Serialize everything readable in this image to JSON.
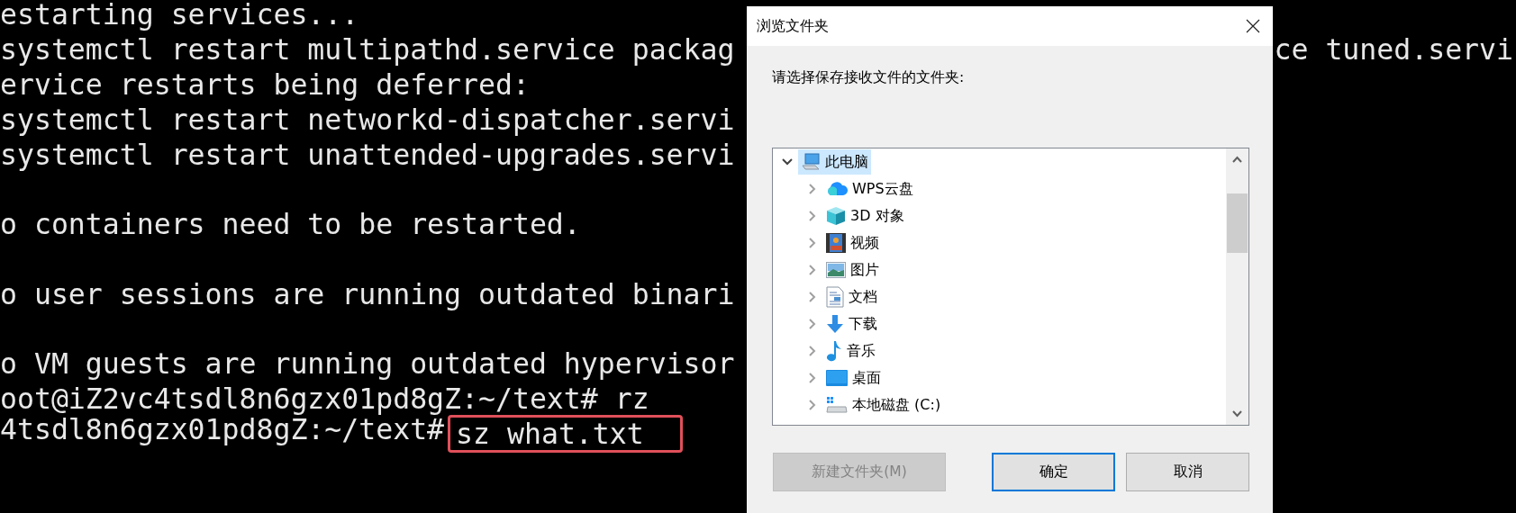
{
  "terminal": {
    "lines": [
      {
        "kind": "text",
        "text": "estarting services..."
      },
      {
        "kind": "text",
        "text": "systemctl restart multipathd.service packag",
        "right_text": "ce tuned.servi"
      },
      {
        "kind": "text",
        "text": "ervice restarts being deferred:"
      },
      {
        "kind": "text",
        "text": "systemctl restart networkd-dispatcher.servi"
      },
      {
        "kind": "text",
        "text": "systemctl restart unattended-upgrades.servi"
      },
      {
        "kind": "blank"
      },
      {
        "kind": "text",
        "text": "o containers need to be restarted."
      },
      {
        "kind": "blank"
      },
      {
        "kind": "text",
        "text": "o user sessions are running outdated binari"
      },
      {
        "kind": "blank"
      },
      {
        "kind": "text",
        "text": "o VM guests are running outdated hypervisor"
      },
      {
        "kind": "text",
        "text": "oot@iZ2vc4tsdl8n6gzx01pd8gZ:~/text# rz"
      },
      {
        "kind": "text",
        "text": "4tsdl8n6gzx01pd8gZ:~/text#",
        "command": "sz what.txt",
        "highlighted": true
      }
    ]
  },
  "dialog": {
    "title": "浏览文件夹",
    "prompt": "请选择保存接收文件的文件夹:",
    "tree": {
      "items": [
        {
          "label": "此电脑",
          "kind": "computer",
          "expanded": true,
          "selected": true,
          "children": [
            {
              "label": "WPS云盘",
              "kind": "cloud",
              "expanded": false,
              "selected": false
            },
            {
              "label": "3D 对象",
              "kind": "cube",
              "expanded": false,
              "selected": false
            },
            {
              "label": "视频",
              "kind": "video",
              "expanded": false,
              "selected": false
            },
            {
              "label": "图片",
              "kind": "pictures",
              "expanded": false,
              "selected": false
            },
            {
              "label": "文档",
              "kind": "document",
              "expanded": false,
              "selected": false
            },
            {
              "label": "下载",
              "kind": "download",
              "expanded": false,
              "selected": false
            },
            {
              "label": "音乐",
              "kind": "music",
              "expanded": false,
              "selected": false
            },
            {
              "label": "桌面",
              "kind": "desktop",
              "expanded": false,
              "selected": false
            },
            {
              "label": "本地磁盘 (C:)",
              "kind": "drive",
              "expanded": false,
              "selected": false
            }
          ]
        }
      ]
    },
    "buttons": [
      {
        "label": "新建文件夹(M)",
        "disabled": true,
        "default": false
      },
      {
        "label": "确定",
        "disabled": false,
        "default": true
      },
      {
        "label": "取消",
        "disabled": false,
        "default": false
      }
    ]
  }
}
